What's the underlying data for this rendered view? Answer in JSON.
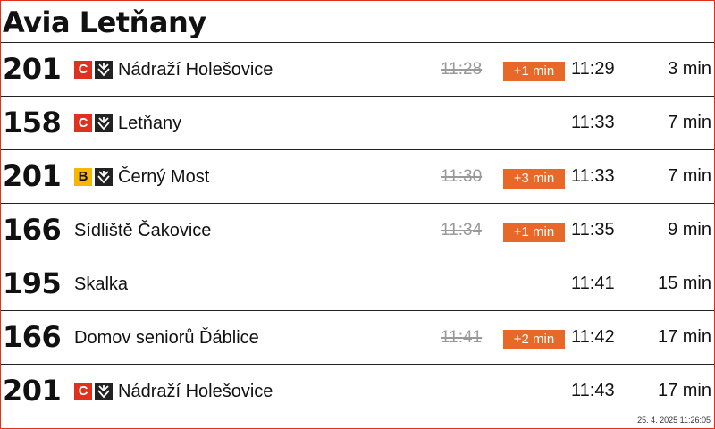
{
  "stop": {
    "name": "Avia Letňany"
  },
  "departures": [
    {
      "line": "201",
      "metro": "C",
      "destination": "Nádraží Holešovice",
      "scheduled": "11:28",
      "delay": "+1 min",
      "time": "11:29",
      "minutes": "3 min"
    },
    {
      "line": "158",
      "metro": "C",
      "destination": "Letňany",
      "scheduled": "",
      "delay": "",
      "time": "11:33",
      "minutes": "7 min"
    },
    {
      "line": "201",
      "metro": "B",
      "destination": "Černý Most",
      "scheduled": "11:30",
      "delay": "+3 min",
      "time": "11:33",
      "minutes": "7 min"
    },
    {
      "line": "166",
      "metro": "",
      "destination": "Sídliště Čakovice",
      "scheduled": "11:34",
      "delay": "+1 min",
      "time": "11:35",
      "minutes": "9 min"
    },
    {
      "line": "195",
      "metro": "",
      "destination": "Skalka",
      "scheduled": "",
      "delay": "",
      "time": "11:41",
      "minutes": "15 min"
    },
    {
      "line": "166",
      "metro": "",
      "destination": "Domov seniorů Ďáblice",
      "scheduled": "11:41",
      "delay": "+2 min",
      "time": "11:42",
      "minutes": "17 min"
    },
    {
      "line": "201",
      "metro": "C",
      "destination": "Nádraží Holešovice",
      "scheduled": "",
      "delay": "",
      "time": "11:43",
      "minutes": "17 min"
    }
  ],
  "footer": {
    "timestamp": "25. 4. 2025 11:26:05"
  },
  "colors": {
    "metro_C": "#e0301e",
    "metro_B": "#f5b800",
    "delay_badge": "#e8682a",
    "frame_border": "#e0301e"
  },
  "icons": {
    "metro_train": "metro-train-icon"
  }
}
